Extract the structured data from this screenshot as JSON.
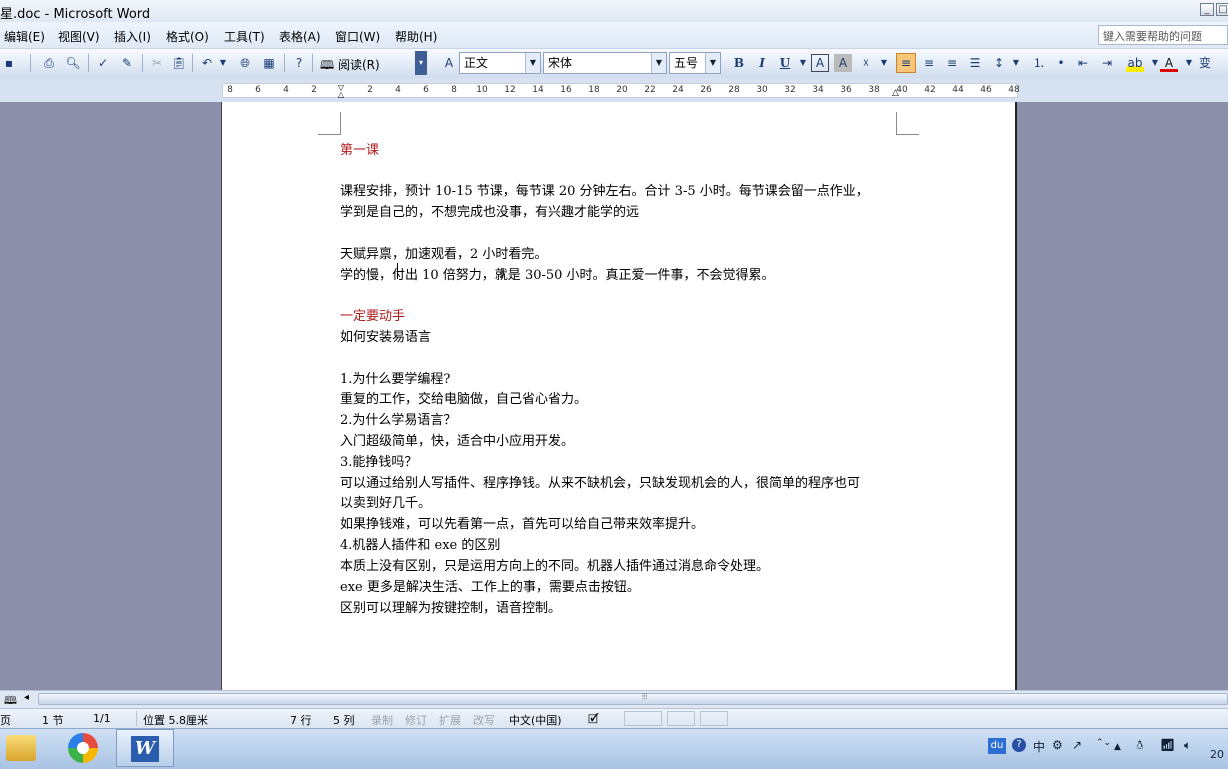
{
  "window": {
    "title": "星.doc - Microsoft Word",
    "help_placeholder": "键入需要帮助的问题"
  },
  "menu": {
    "items": [
      "编辑(E)",
      "视图(V)",
      "插入(I)",
      "格式(O)",
      "工具(T)",
      "表格(A)",
      "窗口(W)",
      "帮助(H)"
    ]
  },
  "toolbar": {
    "read_label": "阅读(R)",
    "style": "正文",
    "font": "宋体",
    "size": "五号",
    "bold": "B",
    "italic": "I",
    "underline": "U"
  },
  "ruler": {
    "numbers": [
      "8",
      "6",
      "4",
      "2",
      "",
      "2",
      "4",
      "6",
      "8",
      "10",
      "12",
      "14",
      "16",
      "18",
      "20",
      "22",
      "24",
      "26",
      "28",
      "30",
      "32",
      "34",
      "36",
      "38",
      "40",
      "42",
      "44",
      "46",
      "48"
    ]
  },
  "document": {
    "lines": [
      {
        "text": "第一课",
        "color": "red"
      },
      {
        "text": "课程安排，预计 10-15 节课，每节课 20 分钟左右。合计 3-5 小时。每节课会留一点作业，"
      },
      {
        "text": "学到是自己的，不想完成也没事，有兴趣才能学的远"
      },
      {
        "text": "天赋异禀，加速观看，2 小时看完。"
      },
      {
        "text": "学的慢，付出 10 倍努力，就是 30-50 小时。真正爱一件事，不会觉得累。"
      },
      {
        "text": "一定要动手",
        "color": "red"
      },
      {
        "text": "如何安装易语言"
      },
      {
        "text": "1.为什么要学编程?"
      },
      {
        "text": "重复的工作，交给电脑做，自己省心省力。"
      },
      {
        "text": "2.为什么学易语言？"
      },
      {
        "text": "入门超级简单，快，适合中小应用开发。"
      },
      {
        "text": "3.能挣钱吗？"
      },
      {
        "text": "可以通过给别人写插件、程序挣钱。从来不缺机会，只缺发现机会的人，很简单的程序也可"
      },
      {
        "text": "以卖到好几千。"
      },
      {
        "text": "如果挣钱难，可以先看第一点，首先可以给自己带来效率提升。"
      },
      {
        "text": "4.机器人插件和 exe 的区别"
      },
      {
        "text": "本质上没有区别，只是运用方向上的不同。机器人插件通过消息命令处理。"
      },
      {
        "text": "exe 更多是解决生活、工作上的事，需要点击按钮。"
      },
      {
        "text": "区别可以理解为按键控制，语音控制。"
      }
    ],
    "red_color": "#b01c1c"
  },
  "status": {
    "page": "页",
    "section": "1 节",
    "pages": "1/1",
    "position": "位置 5.8厘米",
    "line": "7 行",
    "column": "5 列",
    "rec": "录制",
    "trk": "修订",
    "ext": "扩展",
    "ovr": "改写",
    "language": "中文(中国)"
  },
  "taskbar": {
    "tray_du": "du",
    "tray_lang": "中",
    "clock": "20"
  }
}
